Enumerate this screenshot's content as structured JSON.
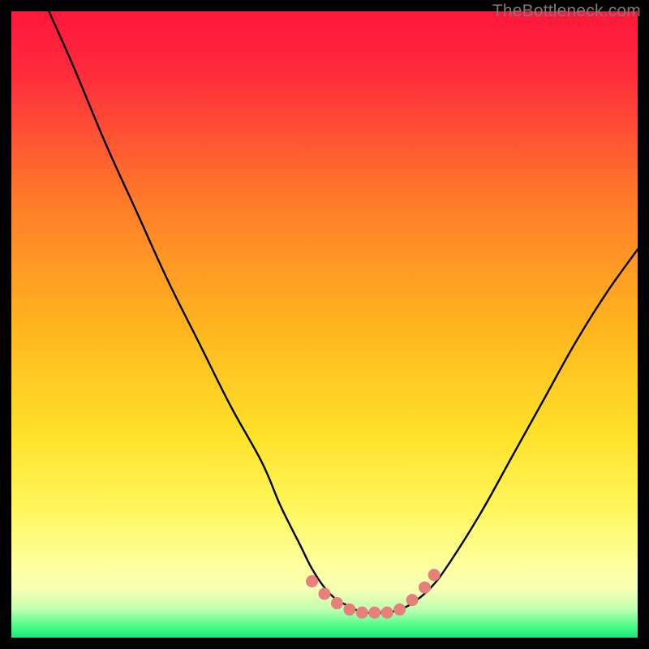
{
  "watermark": "TheBottleneck.com",
  "colors": {
    "gradient_top": "#ff1a3a",
    "gradient_mid": "#ffd400",
    "gradient_bottom_yellow": "#ffff82",
    "gradient_bottom_green": "#2dfc7a",
    "curve": "#000000",
    "dot": "#e77f7a",
    "frame": "#000000"
  },
  "chart_data": {
    "type": "line",
    "title": "",
    "xlabel": "",
    "ylabel": "",
    "xlim": [
      0,
      100
    ],
    "ylim": [
      0,
      100
    ],
    "grid": false,
    "series": [
      {
        "name": "bottleneck-curve",
        "x": [
          6,
          10,
          15,
          20,
          25,
          30,
          35,
          40,
          43,
          46,
          48,
          50,
          52,
          54,
          56,
          58,
          60,
          62,
          64,
          67,
          70,
          75,
          80,
          85,
          90,
          95,
          100
        ],
        "y": [
          100,
          91,
          79,
          68,
          57,
          47,
          37,
          28,
          21,
          15,
          11,
          8,
          6,
          5,
          4,
          4,
          4,
          4.5,
          5.5,
          8,
          12,
          20,
          29,
          38,
          47,
          55,
          62
        ]
      }
    ],
    "dots": {
      "name": "highlight-dots",
      "points": [
        {
          "x": 48,
          "y": 9
        },
        {
          "x": 50,
          "y": 7
        },
        {
          "x": 52,
          "y": 5.5
        },
        {
          "x": 54,
          "y": 4.5
        },
        {
          "x": 56,
          "y": 4
        },
        {
          "x": 58,
          "y": 4
        },
        {
          "x": 60,
          "y": 4
        },
        {
          "x": 62,
          "y": 4.5
        },
        {
          "x": 64,
          "y": 6
        },
        {
          "x": 66,
          "y": 8
        },
        {
          "x": 67.5,
          "y": 10
        }
      ]
    }
  }
}
